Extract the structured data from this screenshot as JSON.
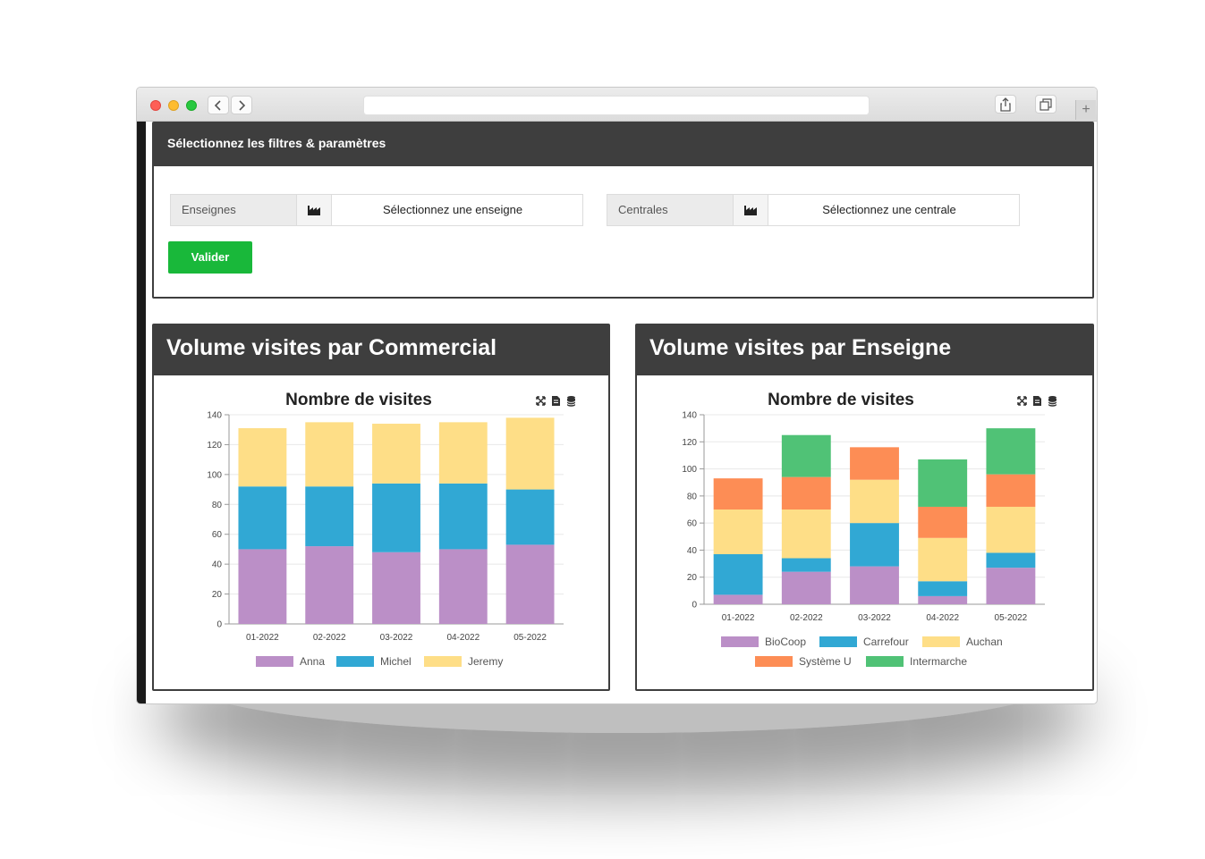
{
  "filters": {
    "title": "Sélectionnez les filtres & paramètres",
    "enseignes_label": "Enseignes",
    "enseignes_select": "Sélectionnez une enseigne",
    "centrales_label": "Centrales",
    "centrales_select": "Sélectionnez une centrale",
    "factory_icon": "factory-icon",
    "validate_label": "Valider"
  },
  "panels": {
    "commercial_title": "Volume visites par Commercial",
    "enseigne_title": "Volume visites par Enseigne"
  },
  "colors": {
    "header_bg": "#3e3e3e",
    "validate_button": "#19b83a"
  },
  "chart_data": [
    {
      "type": "bar",
      "stacked": true,
      "title": "Nombre de visites",
      "categories": [
        "01-2022",
        "02-2022",
        "03-2022",
        "04-2022",
        "05-2022"
      ],
      "series": [
        {
          "name": "Anna",
          "color": "#bb8fc7",
          "values": [
            50,
            52,
            48,
            50,
            53
          ]
        },
        {
          "name": "Michel",
          "color": "#31a8d4",
          "values": [
            42,
            40,
            46,
            44,
            37
          ]
        },
        {
          "name": "Jeremy",
          "color": "#fede87",
          "values": [
            39,
            43,
            40,
            41,
            48
          ]
        }
      ],
      "ylim": [
        0,
        140
      ],
      "yticks": [
        0,
        20,
        40,
        60,
        80,
        100,
        120,
        140
      ],
      "grid": true,
      "legend": "bottom",
      "toolbox_icons": [
        "fullscreen-icon",
        "export-icon",
        "data-view-icon"
      ]
    },
    {
      "type": "bar",
      "stacked": true,
      "title": "Nombre de visites",
      "categories": [
        "01-2022",
        "02-2022",
        "03-2022",
        "04-2022",
        "05-2022"
      ],
      "series": [
        {
          "name": "BioCoop",
          "color": "#bb8fc7",
          "values": [
            7,
            24,
            28,
            6,
            27
          ]
        },
        {
          "name": "Carrefour",
          "color": "#31a8d4",
          "values": [
            30,
            10,
            32,
            11,
            11
          ]
        },
        {
          "name": "Auchan",
          "color": "#fede87",
          "values": [
            33,
            36,
            32,
            32,
            34
          ]
        },
        {
          "name": "Système U",
          "color": "#fd8d55",
          "values": [
            23,
            24,
            24,
            23,
            24
          ]
        },
        {
          "name": "Intermarche",
          "color": "#50c276",
          "values": [
            0,
            31,
            0,
            35,
            34
          ]
        }
      ],
      "ylim": [
        0,
        140
      ],
      "yticks": [
        0,
        20,
        40,
        60,
        80,
        100,
        120,
        140
      ],
      "grid": true,
      "legend": "bottom",
      "toolbox_icons": [
        "fullscreen-icon",
        "export-icon",
        "data-view-icon"
      ]
    }
  ]
}
